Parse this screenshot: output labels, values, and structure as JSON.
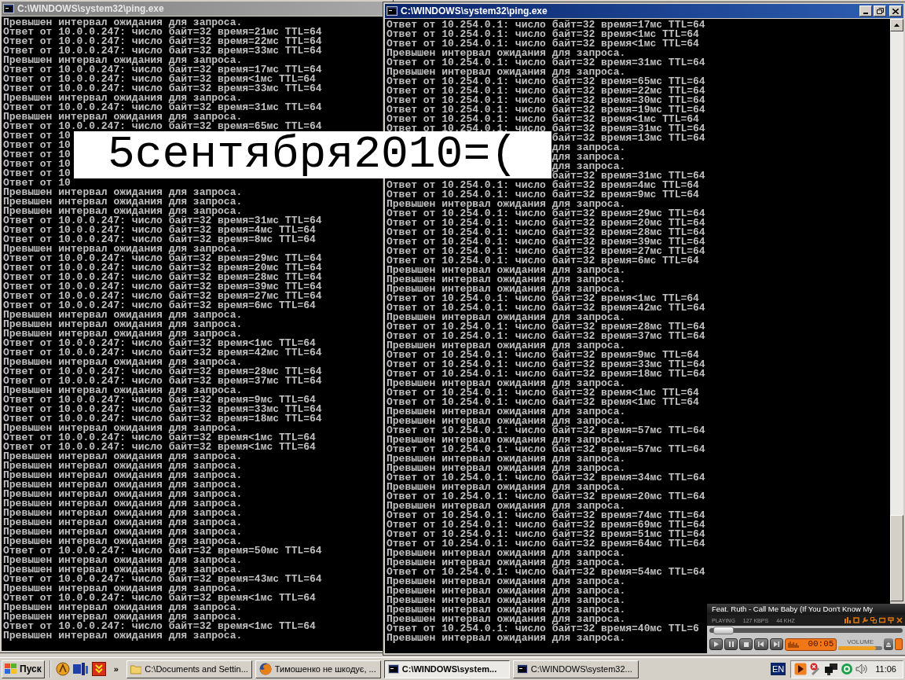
{
  "windows": [
    {
      "title": "C:\\WINDOWS\\system32\\ping.exe",
      "active": false,
      "lines": [
        {
          "kind": "full",
          "text": "Превышен интервал ожидания для запроса."
        },
        {
          "kind": "full",
          "text": "Ответ от 10.0.0.247: число байт=32 время=21мс TTL=64"
        },
        {
          "kind": "full",
          "text": "Ответ от 10.0.0.247: число байт=32 время=22мс TTL=64"
        },
        {
          "kind": "full",
          "text": "Ответ от 10.0.0.247: число байт=32 время=33мс TTL=64"
        },
        {
          "kind": "full",
          "text": "Превышен интервал ожидания для запроса."
        },
        {
          "kind": "full",
          "text": "Ответ от 10.0.0.247: число байт=32 время=17мс TTL=64"
        },
        {
          "kind": "full",
          "text": "Ответ от 10.0.0.247: число байт=32 время<1мс TTL=64"
        },
        {
          "kind": "full",
          "text": "Ответ от 10.0.0.247: число байт=32 время=33мс TTL=64"
        },
        {
          "kind": "full",
          "text": "Превышен интервал ожидания для запроса."
        },
        {
          "kind": "full",
          "text": "Ответ от 10.0.0.247: число байт=32 время=31мс TTL=64"
        },
        {
          "kind": "full",
          "text": "Превышен интервал ожидания для запроса."
        },
        {
          "kind": "full",
          "text": "Ответ от 10.0.0.247: число байт=32 время=65мс TTL=64"
        },
        {
          "kind": "full",
          "text": "Ответ от 10"
        },
        {
          "kind": "full",
          "text": "Ответ от 10"
        },
        {
          "kind": "full",
          "text": "Ответ от 10"
        },
        {
          "kind": "full",
          "text": "Ответ от 10"
        },
        {
          "kind": "full",
          "text": "Ответ от 10"
        },
        {
          "kind": "full",
          "text": "Ответ от 10"
        },
        {
          "kind": "full",
          "text": "Превышен интервал ожидания для запроса."
        },
        {
          "kind": "full",
          "text": "Превышен интервал ожидания для запроса."
        },
        {
          "kind": "full",
          "text": "Превышен интервал ожидания для запроса."
        },
        {
          "kind": "full",
          "text": "Ответ от 10.0.0.247: число байт=32 время=31мс TTL=64"
        },
        {
          "kind": "full",
          "text": "Ответ от 10.0.0.247: число байт=32 время=4мс TTL=64"
        },
        {
          "kind": "full",
          "text": "Ответ от 10.0.0.247: число байт=32 время=8мс TTL=64"
        },
        {
          "kind": "full",
          "text": "Превышен интервал ожидания для запроса."
        },
        {
          "kind": "full",
          "text": "Ответ от 10.0.0.247: число байт=32 время=29мс TTL=64"
        },
        {
          "kind": "full",
          "text": "Ответ от 10.0.0.247: число байт=32 время=20мс TTL=64"
        },
        {
          "kind": "full",
          "text": "Ответ от 10.0.0.247: число байт=32 время=28мс TTL=64"
        },
        {
          "kind": "full",
          "text": "Ответ от 10.0.0.247: число байт=32 время=39мс TTL=64"
        },
        {
          "kind": "full",
          "text": "Ответ от 10.0.0.247: число байт=32 время=27мс TTL=64"
        },
        {
          "kind": "full",
          "text": "Ответ от 10.0.0.247: число байт=32 время=6мс TTL=64"
        },
        {
          "kind": "full",
          "text": "Превышен интервал ожидания для запроса."
        },
        {
          "kind": "full",
          "text": "Превышен интервал ожидания для запроса."
        },
        {
          "kind": "full",
          "text": "Превышен интервал ожидания для запроса."
        },
        {
          "kind": "full",
          "text": "Ответ от 10.0.0.247: число байт=32 время<1мс TTL=64"
        },
        {
          "kind": "full",
          "text": "Ответ от 10.0.0.247: число байт=32 время=42мс TTL=64"
        },
        {
          "kind": "full",
          "text": "Превышен интервал ожидания для запроса."
        },
        {
          "kind": "full",
          "text": "Ответ от 10.0.0.247: число байт=32 время=28мс TTL=64"
        },
        {
          "kind": "full",
          "text": "Ответ от 10.0.0.247: число байт=32 время=37мс TTL=64"
        },
        {
          "kind": "full",
          "text": "Превышен интервал ожидания для запроса."
        },
        {
          "kind": "full",
          "text": "Ответ от 10.0.0.247: число байт=32 время=9мс TTL=64"
        },
        {
          "kind": "full",
          "text": "Ответ от 10.0.0.247: число байт=32 время=33мс TTL=64"
        },
        {
          "kind": "full",
          "text": "Ответ от 10.0.0.247: число байт=32 время=18мс TTL=64"
        },
        {
          "kind": "full",
          "text": "Превышен интервал ожидания для запроса."
        },
        {
          "kind": "full",
          "text": "Ответ от 10.0.0.247: число байт=32 время<1мс TTL=64"
        },
        {
          "kind": "full",
          "text": "Ответ от 10.0.0.247: число байт=32 время<1мс TTL=64"
        },
        {
          "kind": "full",
          "text": "Превышен интервал ожидания для запроса."
        },
        {
          "kind": "full",
          "text": "Превышен интервал ожидания для запроса."
        },
        {
          "kind": "full",
          "text": "Превышен интервал ожидания для запроса."
        },
        {
          "kind": "full",
          "text": "Превышен интервал ожидания для запроса."
        },
        {
          "kind": "full",
          "text": "Превышен интервал ожидания для запроса."
        },
        {
          "kind": "full",
          "text": "Превышен интервал ожидания для запроса."
        },
        {
          "kind": "full",
          "text": "Превышен интервал ожидания для запроса."
        },
        {
          "kind": "full",
          "text": "Превышен интервал ожидания для запроса."
        },
        {
          "kind": "full",
          "text": "Превышен интервал ожидания для запроса."
        },
        {
          "kind": "full",
          "text": "Превышен интервал ожидания для запроса."
        },
        {
          "kind": "full",
          "text": "Ответ от 10.0.0.247: число байт=32 время=50мс TTL=64"
        },
        {
          "kind": "full",
          "text": "Превышен интервал ожидания для запроса."
        },
        {
          "kind": "full",
          "text": "Превышен интервал ожидания для запроса."
        },
        {
          "kind": "full",
          "text": "Ответ от 10.0.0.247: число байт=32 время=43мс TTL=64"
        },
        {
          "kind": "full",
          "text": "Превышен интервал ожидания для запроса."
        },
        {
          "kind": "full",
          "text": "Ответ от 10.0.0.247: число байт=32 время<1мс TTL=64"
        },
        {
          "kind": "full",
          "text": "Превышен интервал ожидания для запроса."
        },
        {
          "kind": "full",
          "text": "Превышен интервал ожидания для запроса."
        },
        {
          "kind": "full",
          "text": "Ответ от 10.0.0.247: число байт=32 время<1мс TTL=64"
        },
        {
          "kind": "full",
          "text": "Превышен интервал ожидания для запроса."
        }
      ]
    },
    {
      "title": "C:\\WINDOWS\\system32\\ping.exe",
      "active": true,
      "lines": [
        {
          "kind": "full",
          "text": "Ответ от 10.254.0.1: число байт=32 время=17мс TTL=64"
        },
        {
          "kind": "full",
          "text": "Ответ от 10.254.0.1: число байт=32 время<1мс TTL=64"
        },
        {
          "kind": "full",
          "text": "Ответ от 10.254.0.1: число байт=32 время<1мс TTL=64"
        },
        {
          "kind": "full",
          "text": "Превышен интервал ожидания для запроса."
        },
        {
          "kind": "full",
          "text": "Ответ от 10.254.0.1: число байт=32 время=31мс TTL=64"
        },
        {
          "kind": "full",
          "text": "Превышен интервал ожидания для запроса."
        },
        {
          "kind": "full",
          "text": "Ответ от 10.254.0.1: число байт=32 время=65мс TTL=64"
        },
        {
          "kind": "full",
          "text": "Ответ от 10.254.0.1: число байт=32 время=22мс TTL=64"
        },
        {
          "kind": "full",
          "text": "Ответ от 10.254.0.1: число байт=32 время=30мс TTL=64"
        },
        {
          "kind": "full",
          "text": "Ответ от 10.254.0.1: число байт=32 время=19мс TTL=64"
        },
        {
          "kind": "full",
          "text": "Ответ от 10.254.0.1: число байт=32 время<1мс TTL=64"
        },
        {
          "kind": "full",
          "text": "Ответ от 10.254.0.1: число байт=32 время=31мс TTL=64"
        },
        {
          "kind": "tail",
          "text": "байт=32 время=13мс TTL=64"
        },
        {
          "kind": "tail",
          "text": "для запроса."
        },
        {
          "kind": "tail",
          "text": "для запроса."
        },
        {
          "kind": "tail",
          "text": "для запроса."
        },
        {
          "kind": "tail",
          "text": "байт=32 время=31мс TTL=64"
        },
        {
          "kind": "full",
          "text": "Ответ от 10.254.0.1: число байт=32 время=4мс TTL=64"
        },
        {
          "kind": "full",
          "text": "Ответ от 10.254.0.1: число байт=32 время=9мс TTL=64"
        },
        {
          "kind": "full",
          "text": "Превышен интервал ожидания для запроса."
        },
        {
          "kind": "full",
          "text": "Ответ от 10.254.0.1: число байт=32 время=29мс TTL=64"
        },
        {
          "kind": "full",
          "text": "Ответ от 10.254.0.1: число байт=32 время=20мс TTL=64"
        },
        {
          "kind": "full",
          "text": "Ответ от 10.254.0.1: число байт=32 время=28мс TTL=64"
        },
        {
          "kind": "full",
          "text": "Ответ от 10.254.0.1: число байт=32 время=39мс TTL=64"
        },
        {
          "kind": "full",
          "text": "Ответ от 10.254.0.1: число байт=32 время=27мс TTL=64"
        },
        {
          "kind": "full",
          "text": "Ответ от 10.254.0.1: число байт=32 время=6мс TTL=64"
        },
        {
          "kind": "full",
          "text": "Превышен интервал ожидания для запроса."
        },
        {
          "kind": "full",
          "text": "Превышен интервал ожидания для запроса."
        },
        {
          "kind": "full",
          "text": "Превышен интервал ожидания для запроса."
        },
        {
          "kind": "full",
          "text": "Ответ от 10.254.0.1: число байт=32 время<1мс TTL=64"
        },
        {
          "kind": "full",
          "text": "Ответ от 10.254.0.1: число байт=32 время=42мс TTL=64"
        },
        {
          "kind": "full",
          "text": "Превышен интервал ожидания для запроса."
        },
        {
          "kind": "full",
          "text": "Ответ от 10.254.0.1: число байт=32 время=28мс TTL=64"
        },
        {
          "kind": "full",
          "text": "Ответ от 10.254.0.1: число байт=32 время=37мс TTL=64"
        },
        {
          "kind": "full",
          "text": "Превышен интервал ожидания для запроса."
        },
        {
          "kind": "full",
          "text": "Ответ от 10.254.0.1: число байт=32 время=9мс TTL=64"
        },
        {
          "kind": "full",
          "text": "Ответ от 10.254.0.1: число байт=32 время=33мс TTL=64"
        },
        {
          "kind": "full",
          "text": "Ответ от 10.254.0.1: число байт=32 время=18мс TTL=64"
        },
        {
          "kind": "full",
          "text": "Превышен интервал ожидания для запроса."
        },
        {
          "kind": "full",
          "text": "Ответ от 10.254.0.1: число байт=32 время<1мс TTL=64"
        },
        {
          "kind": "full",
          "text": "Ответ от 10.254.0.1: число байт=32 время<1мс TTL=64"
        },
        {
          "kind": "full",
          "text": "Превышен интервал ожидания для запроса."
        },
        {
          "kind": "full",
          "text": "Превышен интервал ожидания для запроса."
        },
        {
          "kind": "full",
          "text": "Ответ от 10.254.0.1: число байт=32 время=57мс TTL=64"
        },
        {
          "kind": "full",
          "text": "Превышен интервал ожидания для запроса."
        },
        {
          "kind": "full",
          "text": "Ответ от 10.254.0.1: число байт=32 время=57мс TTL=64"
        },
        {
          "kind": "full",
          "text": "Превышен интервал ожидания для запроса."
        },
        {
          "kind": "full",
          "text": "Превышен интервал ожидания для запроса."
        },
        {
          "kind": "full",
          "text": "Ответ от 10.254.0.1: число байт=32 время=34мс TTL=64"
        },
        {
          "kind": "full",
          "text": "Превышен интервал ожидания для запроса."
        },
        {
          "kind": "full",
          "text": "Ответ от 10.254.0.1: число байт=32 время=20мс TTL=64"
        },
        {
          "kind": "full",
          "text": "Превышен интервал ожидания для запроса."
        },
        {
          "kind": "full",
          "text": "Ответ от 10.254.0.1: число байт=32 время=74мс TTL=64"
        },
        {
          "kind": "full",
          "text": "Ответ от 10.254.0.1: число байт=32 время=69мс TTL=64"
        },
        {
          "kind": "full",
          "text": "Ответ от 10.254.0.1: число байт=32 время=51мс TTL=64"
        },
        {
          "kind": "full",
          "text": "Ответ от 10.254.0.1: число байт=32 время=64мс TTL=64"
        },
        {
          "kind": "full",
          "text": "Превышен интервал ожидания для запроса."
        },
        {
          "kind": "full",
          "text": "Превышен интервал ожидания для запроса."
        },
        {
          "kind": "full",
          "text": "Ответ от 10.254.0.1: число байт=32 время=54мс TTL=64"
        },
        {
          "kind": "full",
          "text": "Превышен интервал ожидания для запроса."
        },
        {
          "kind": "full",
          "text": "Превышен интервал ожидания для запроса."
        },
        {
          "kind": "full",
          "text": "Превышен интервал ожидания для запроса."
        },
        {
          "kind": "full",
          "text": "Превышен интервал ожидания для запроса."
        },
        {
          "kind": "full",
          "text": "Превышен интервал ожидания для запроса."
        },
        {
          "kind": "full",
          "text": "Ответ от 10.254.0.1: число байт=32 время=40мс TTL=6"
        },
        {
          "kind": "full",
          "text": "Превышен интервал ожидания для запроса."
        }
      ]
    }
  ],
  "overlay": {
    "text": "5сентября2010=("
  },
  "player": {
    "track": "Feat. Ruth - Call Me Baby (If You Don't Know My",
    "status": "PLAYING",
    "bitrate": "127 KBPS",
    "samplerate": "44 KHZ",
    "seek": {
      "level": 0.06
    },
    "time": "00:05",
    "volume_label": "VOLUME",
    "volume": {
      "level": 0.85
    }
  },
  "taskbar": {
    "start": "Пуск",
    "more": "»",
    "tasks": [
      {
        "kind": "folder",
        "label": "C:\\Documents and Settin...",
        "selected": false
      },
      {
        "kind": "browser",
        "label": "Тимошенко не шкодує, ...",
        "selected": false
      },
      {
        "kind": "console",
        "label": "C:\\WINDOWS\\system...",
        "selected": true
      },
      {
        "kind": "console",
        "label": "C:\\WINDOWS\\system32...",
        "selected": false
      }
    ],
    "language": "EN",
    "clock": "11:06"
  }
}
